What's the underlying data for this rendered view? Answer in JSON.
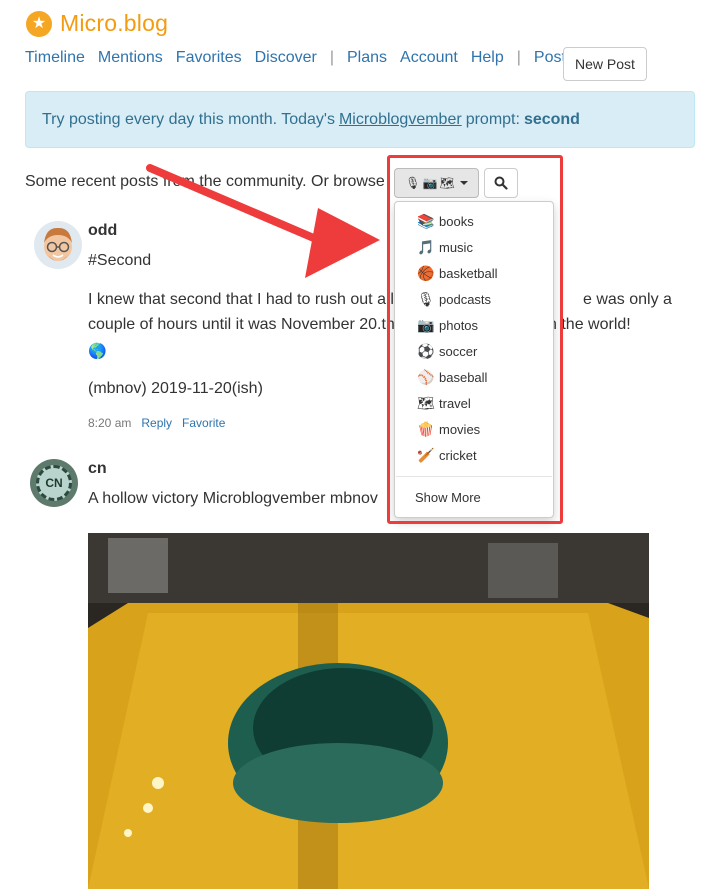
{
  "app": {
    "name": "Micro.blog"
  },
  "nav": {
    "items": [
      "Timeline",
      "Mentions",
      "Favorites",
      "Discover",
      "Plans",
      "Account",
      "Help",
      "Posts"
    ],
    "new_post": "New Post"
  },
  "banner": {
    "prefix": "Try posting every day this month. Today's",
    "link": "Microblogvember",
    "middle": "prompt:",
    "prompt": "second"
  },
  "intro": "Some recent posts from the community. Or browse",
  "dropdown": {
    "items": [
      {
        "icon": "books-icon",
        "glyph": "📚",
        "label": "books"
      },
      {
        "icon": "music-icon",
        "glyph": "🎵",
        "label": "music"
      },
      {
        "icon": "basketball-icon",
        "glyph": "🏀",
        "label": "basketball"
      },
      {
        "icon": "podcasts-icon",
        "glyph": "🎙",
        "label": "podcasts"
      },
      {
        "icon": "photos-icon",
        "glyph": "📷",
        "label": "photos"
      },
      {
        "icon": "soccer-icon",
        "glyph": "⚽",
        "label": "soccer"
      },
      {
        "icon": "baseball-icon",
        "glyph": "⚾",
        "label": "baseball"
      },
      {
        "icon": "travel-icon",
        "glyph": "🗺",
        "label": "travel"
      },
      {
        "icon": "movies-icon",
        "glyph": "🍿",
        "label": "movies"
      },
      {
        "icon": "cricket-icon",
        "glyph": "🏏",
        "label": "cricket"
      }
    ],
    "show_more": "Show More"
  },
  "posts": [
    {
      "username": "odd",
      "line1": "#Second",
      "line2": "I knew that second that I had to rush out a l",
      "line2_end": "e was only a",
      "line3": "couple of hours until it was November 20.th",
      "line3_end": "n the world!",
      "line4": "(mbnov) 2019-11-20(ish)",
      "time": "8:20 am",
      "reply": "Reply",
      "favorite": "Favorite"
    },
    {
      "username": "cn",
      "avatar_text": "CN",
      "text": "A hollow victory Microblogvember mbnov"
    }
  ],
  "colors": {
    "accent": "#f39c12",
    "link": "#2f74ad",
    "banner_bg": "#d9edf7",
    "highlight": "#ee3b3b"
  }
}
